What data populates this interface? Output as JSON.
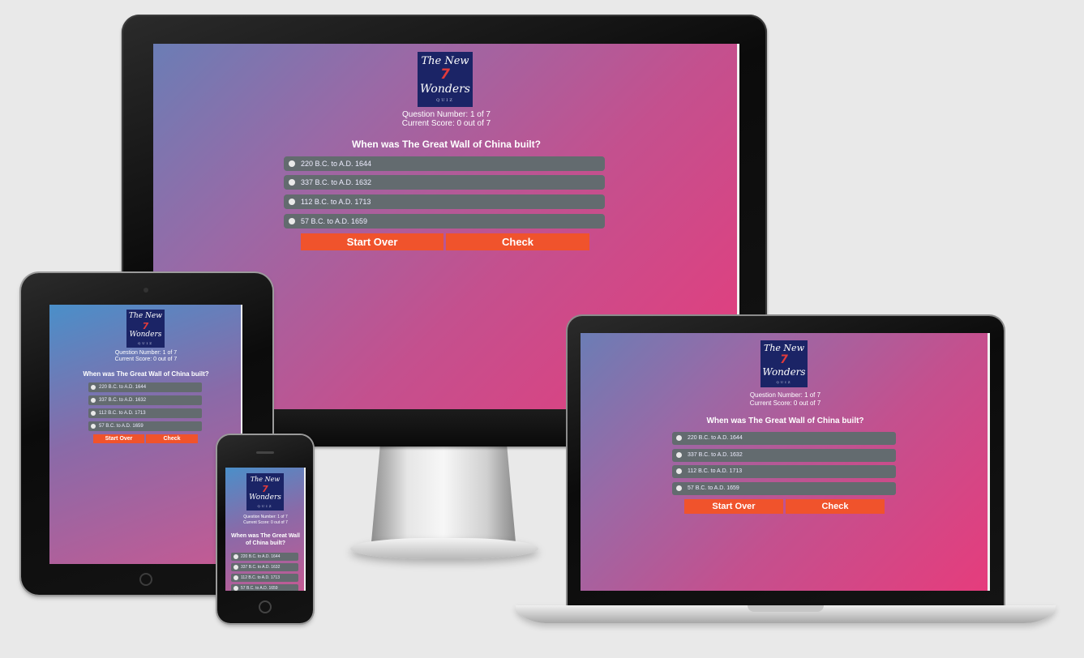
{
  "quiz": {
    "logo": {
      "line1": "The New",
      "number": "7",
      "line2": "Wonders",
      "sub": "QUIZ"
    },
    "question_number": "Question Number: 1 of 7",
    "current_score": "Current Score: 0 out of 7",
    "question": "When was The Great Wall of China built?",
    "question_line1": "When was The Great Wall",
    "question_line2": "of China built?",
    "options": [
      "220 B.C. to A.D. 1644",
      "337 B.C. to A.D. 1632",
      "112 B.C. to A.D. 1713",
      "57 B.C. to A.D. 1659"
    ],
    "start_over_label": "Start Over",
    "check_label": "Check"
  },
  "colors": {
    "page_bg": "#e9e9e9",
    "gradient_start": "#6b7db5",
    "gradient_end": "#e63c7c",
    "logo_bg": "#1b2466",
    "option_bg": "#636b6f",
    "button_bg": "#f0532c"
  }
}
